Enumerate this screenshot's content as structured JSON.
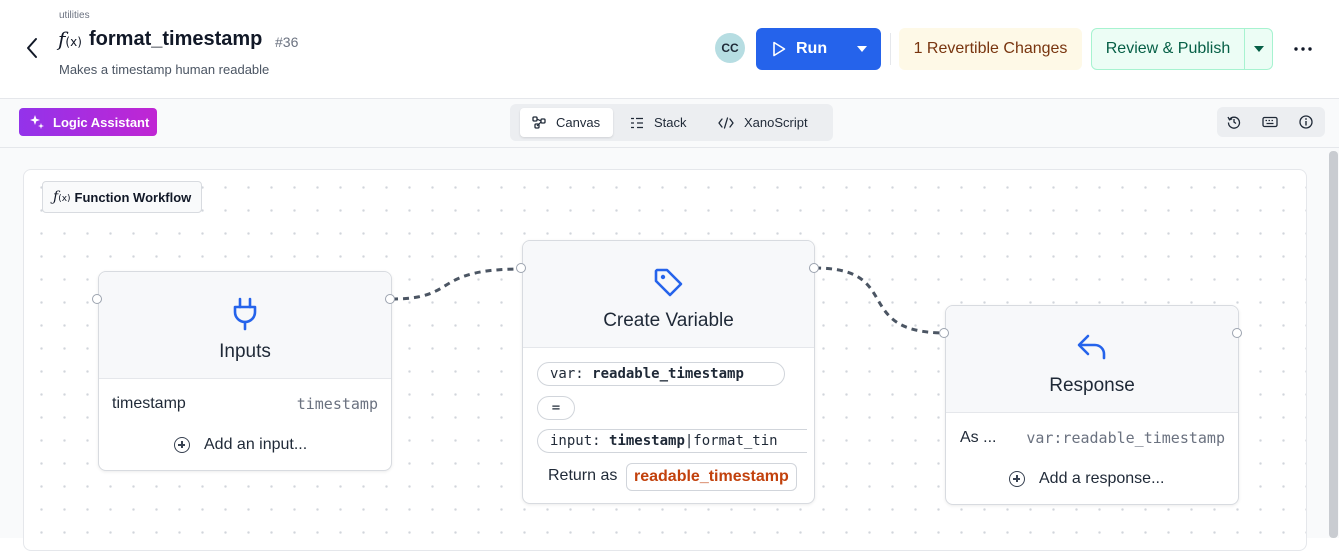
{
  "header": {
    "breadcrumb": "utilities",
    "fn_icon": "f",
    "fn_icon_sub": "(x)",
    "title": "format_timestamp",
    "id": "#36",
    "subtitle": "Makes a timestamp human readable",
    "avatar": "CC",
    "run_label": "Run",
    "revertible_label": "1 Revertible Changes",
    "publish_label": "Review & Publish",
    "more_icon": "more-horizontal-icon"
  },
  "toolbar": {
    "assistant_label": "Logic Assistant",
    "tabs": [
      {
        "label": "Canvas",
        "icon": "canvas-icon",
        "active": true
      },
      {
        "label": "Stack",
        "icon": "stack-icon",
        "active": false
      },
      {
        "label": "XanoScript",
        "icon": "code-icon",
        "active": false
      }
    ],
    "right_icons": [
      "history-icon",
      "keyboard-icon",
      "info-icon"
    ]
  },
  "canvas": {
    "workflow_label": "Function Workflow",
    "inputs_node": {
      "title": "Inputs",
      "icon": "plug-icon",
      "rows": [
        {
          "name": "timestamp",
          "type": "timestamp"
        }
      ],
      "add_label": "Add an input..."
    },
    "variable_node": {
      "title": "Create Variable",
      "icon": "tag-icon",
      "var_prefix": "var:",
      "var_name": "readable_timestamp",
      "equals": "=",
      "input_prefix": "input:",
      "input_name": "timestamp",
      "input_filter": "|format_tin",
      "return_label": "Return as",
      "return_value": "readable_timestamp"
    },
    "response_node": {
      "title": "Response",
      "icon": "reply-icon",
      "as_label": "As ...",
      "as_value": "var:readable_timestamp",
      "add_label": "Add a response..."
    }
  },
  "colors": {
    "primary": "#2563eb",
    "revertible_bg": "#fef9e7",
    "publish_bg": "#ecfdf5",
    "assistant": "#a21caf",
    "return_value": "#c2410c",
    "icon_blue": "#2563eb"
  }
}
